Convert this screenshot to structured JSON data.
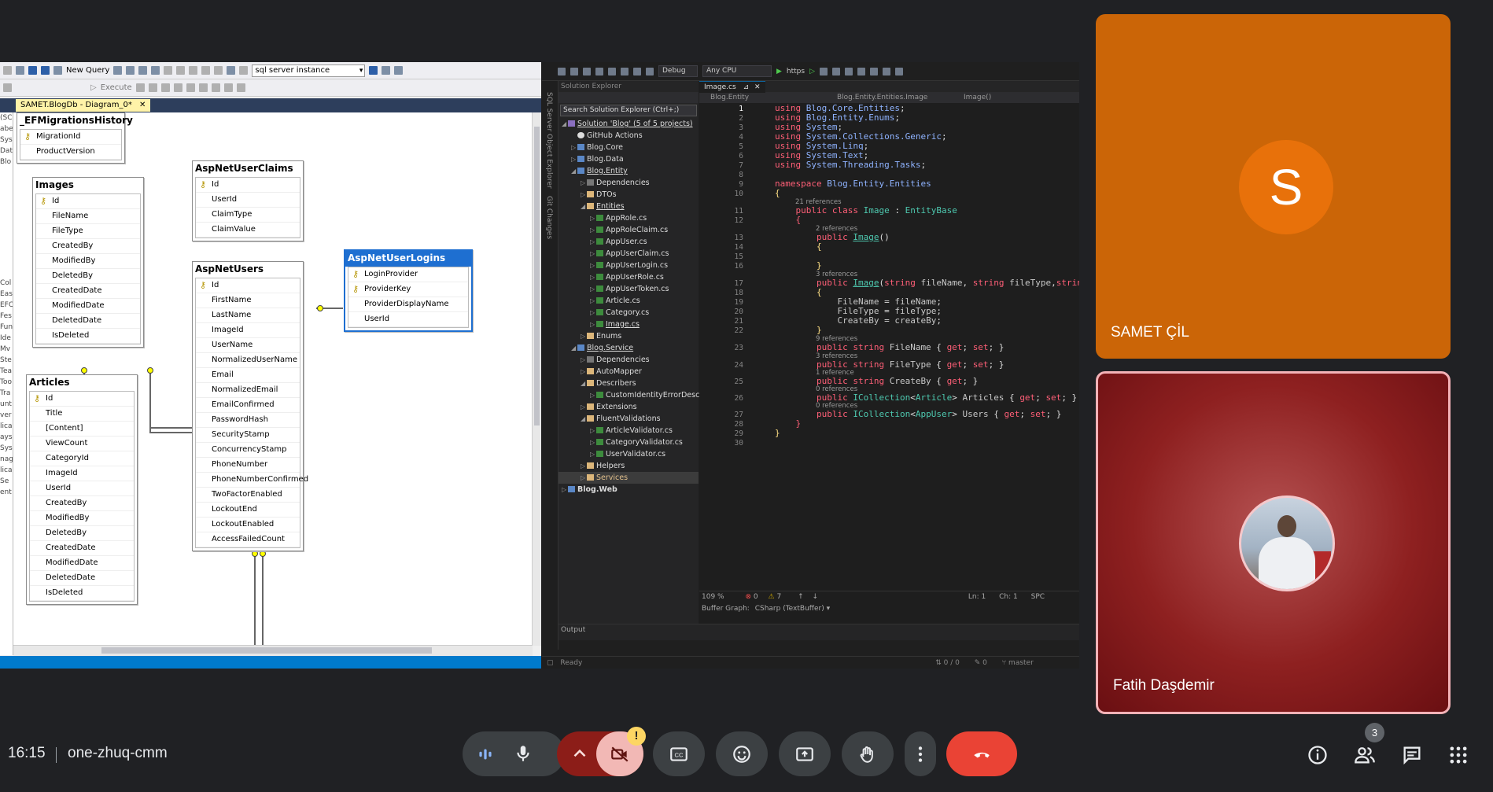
{
  "ssms": {
    "toolbar": {
      "new_query": "New Query",
      "execute": "Execute",
      "instance": "sql server instance"
    },
    "tab": "SAMET.BlogDb - Diagram_0*",
    "left_strip": [
      "(SC",
      "abe",
      "Sys",
      "Dat",
      "Blo",
      "",
      "",
      "",
      "",
      "",
      "",
      "",
      "",
      "",
      "",
      "Col",
      "Eas",
      "EFC",
      "Fes",
      "Fun",
      "Ide",
      "Mv",
      "Ste",
      "Tea",
      "Too",
      "Tra",
      "unt",
      "ver",
      "lica",
      "ays",
      "Sys",
      "nag",
      "lica",
      "Se",
      "ent"
    ],
    "tables": {
      "migrations": {
        "title": "_EFMigrationsHistory",
        "cols": [
          "MigrationId",
          "ProductVersion"
        ]
      },
      "images": {
        "title": "Images",
        "cols": [
          "Id",
          "FileName",
          "FileType",
          "CreatedBy",
          "ModifiedBy",
          "DeletedBy",
          "CreatedDate",
          "ModifiedDate",
          "DeletedDate",
          "IsDeleted"
        ]
      },
      "claims": {
        "title": "AspNetUserClaims",
        "cols": [
          "Id",
          "UserId",
          "ClaimType",
          "ClaimValue"
        ]
      },
      "users": {
        "title": "AspNetUsers",
        "cols": [
          "Id",
          "FirstName",
          "LastName",
          "ImageId",
          "UserName",
          "NormalizedUserName",
          "Email",
          "NormalizedEmail",
          "EmailConfirmed",
          "PasswordHash",
          "SecurityStamp",
          "ConcurrencyStamp",
          "PhoneNumber",
          "PhoneNumberConfirmed",
          "TwoFactorEnabled",
          "LockoutEnd",
          "LockoutEnabled",
          "AccessFailedCount"
        ]
      },
      "logins": {
        "title": "AspNetUserLogins",
        "cols": [
          "LoginProvider",
          "ProviderKey",
          "ProviderDisplayName",
          "UserId"
        ]
      },
      "articles": {
        "title": "Articles",
        "cols": [
          "Id",
          "Title",
          "[Content]",
          "ViewCount",
          "CategoryId",
          "ImageId",
          "UserId",
          "CreatedBy",
          "ModifiedBy",
          "DeletedBy",
          "CreatedDate",
          "ModifiedDate",
          "DeletedDate",
          "IsDeleted"
        ]
      }
    }
  },
  "vs": {
    "toolbar": {
      "config": "Debug",
      "platform": "Any CPU",
      "run": "https"
    },
    "side_labels": [
      "SQL Server Object Explorer",
      "Git Changes"
    ],
    "solution_explorer": {
      "title": "Solution Explorer",
      "search": "Search Solution Explorer (Ctrl+;)",
      "items": [
        {
          "label": "Solution 'Blog' (5 of 5 projects)",
          "indent": 0,
          "icon": "sol",
          "arrow": "◢",
          "u": true
        },
        {
          "label": "GitHub Actions",
          "indent": 1,
          "icon": "gh",
          "arrow": ""
        },
        {
          "label": "Blog.Core",
          "indent": 1,
          "icon": "prj",
          "arrow": "▷"
        },
        {
          "label": "Blog.Data",
          "indent": 1,
          "icon": "prj",
          "arrow": "▷"
        },
        {
          "label": "Blog.Entity",
          "indent": 1,
          "icon": "prj",
          "arrow": "◢",
          "u": true
        },
        {
          "label": "Dependencies",
          "indent": 2,
          "icon": "dep",
          "arrow": "▷"
        },
        {
          "label": "DTOs",
          "indent": 2,
          "icon": "fld",
          "arrow": "▷"
        },
        {
          "label": "Entities",
          "indent": 2,
          "icon": "fld",
          "arrow": "◢",
          "u": true
        },
        {
          "label": "AppRole.cs",
          "indent": 3,
          "icon": "cs",
          "arrow": "▷"
        },
        {
          "label": "AppRoleClaim.cs",
          "indent": 3,
          "icon": "cs",
          "arrow": "▷"
        },
        {
          "label": "AppUser.cs",
          "indent": 3,
          "icon": "cs",
          "arrow": "▷"
        },
        {
          "label": "AppUserClaim.cs",
          "indent": 3,
          "icon": "cs",
          "arrow": "▷"
        },
        {
          "label": "AppUserLogin.cs",
          "indent": 3,
          "icon": "cs",
          "arrow": "▷"
        },
        {
          "label": "AppUserRole.cs",
          "indent": 3,
          "icon": "cs",
          "arrow": "▷"
        },
        {
          "label": "AppUserToken.cs",
          "indent": 3,
          "icon": "cs",
          "arrow": "▷"
        },
        {
          "label": "Article.cs",
          "indent": 3,
          "icon": "cs",
          "arrow": "▷"
        },
        {
          "label": "Category.cs",
          "indent": 3,
          "icon": "cs",
          "arrow": "▷"
        },
        {
          "label": "Image.cs",
          "indent": 3,
          "icon": "cs",
          "arrow": "▷",
          "u": true
        },
        {
          "label": "Enums",
          "indent": 2,
          "icon": "fld",
          "arrow": "▷"
        },
        {
          "label": "Blog.Service",
          "indent": 1,
          "icon": "prj",
          "arrow": "◢",
          "u": true
        },
        {
          "label": "Dependencies",
          "indent": 2,
          "icon": "dep",
          "arrow": "▷"
        },
        {
          "label": "AutoMapper",
          "indent": 2,
          "icon": "fld",
          "arrow": "▷"
        },
        {
          "label": "Describers",
          "indent": 2,
          "icon": "fld",
          "arrow": "◢"
        },
        {
          "label": "CustomIdentityErrorDescriber.cs",
          "indent": 3,
          "icon": "cs",
          "arrow": "▷"
        },
        {
          "label": "Extensions",
          "indent": 2,
          "icon": "fld",
          "arrow": "▷"
        },
        {
          "label": "FluentValidations",
          "indent": 2,
          "icon": "fld",
          "arrow": "◢"
        },
        {
          "label": "ArticleValidator.cs",
          "indent": 3,
          "icon": "cs",
          "arrow": "▷"
        },
        {
          "label": "CategoryValidator.cs",
          "indent": 3,
          "icon": "cs",
          "arrow": "▷"
        },
        {
          "label": "UserValidator.cs",
          "indent": 3,
          "icon": "cs",
          "arrow": "▷"
        },
        {
          "label": "Helpers",
          "indent": 2,
          "icon": "fld",
          "arrow": "▷"
        },
        {
          "label": "Services",
          "indent": 2,
          "icon": "fld",
          "arrow": "▷",
          "y": true,
          "hl": true
        },
        {
          "label": "Blog.Web",
          "indent": 0,
          "icon": "prj",
          "arrow": "▷",
          "bold": true
        }
      ]
    },
    "editor": {
      "tab": "Image.cs",
      "nav": [
        "Blog.Entity",
        "Blog.Entity.Entities.Image",
        "Image()"
      ],
      "zoom": "109 %",
      "errors": "0",
      "warnings": "7",
      "position": "Ln: 1",
      "char": "Ch: 1",
      "spc": "SPC",
      "buffer": "Buffer Graph:",
      "buffer_combo": "CSharp (TextBuffer)"
    },
    "output_label": "Output",
    "status": {
      "ready": "Ready",
      "updown": "0 / 0",
      "pencil": "0",
      "branch": "master"
    }
  },
  "participants": [
    {
      "name": "SAMET ÇİL",
      "initial": "S"
    },
    {
      "name": "Fatih Daşdemir"
    }
  ],
  "bottom": {
    "time": "16:15",
    "meeting_code": "one-zhuq-cmm",
    "people_count": "3",
    "camera_warning": "!"
  }
}
